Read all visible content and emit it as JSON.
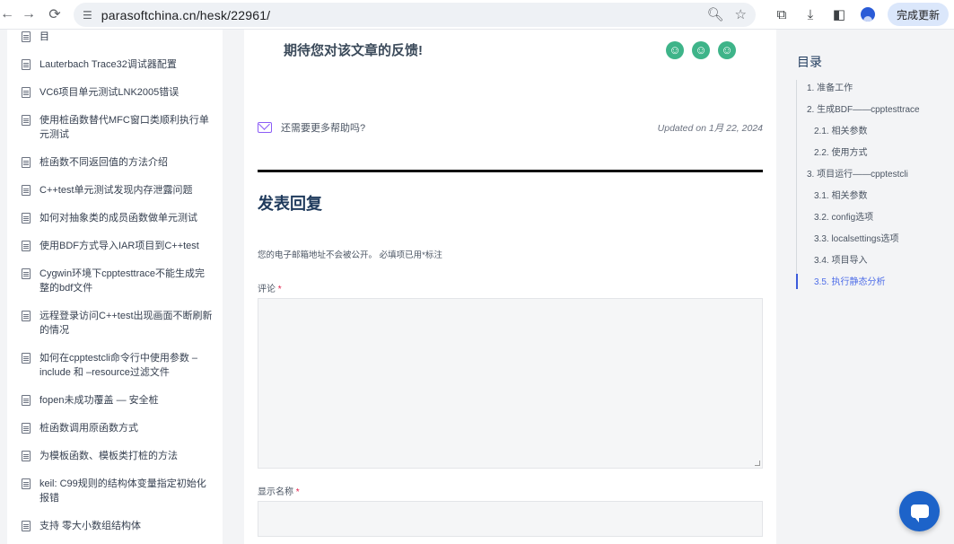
{
  "browser": {
    "url": "parasoftchina.cn/hesk/22961/",
    "update_button": "完成更新"
  },
  "sidebar": {
    "items": [
      {
        "label": "目"
      },
      {
        "label": "Lauterbach Trace32调试器配置"
      },
      {
        "label": "VC6项目单元测试LNK2005错误"
      },
      {
        "label": "使用桩函数替代MFC窗口类顺利执行单元测试"
      },
      {
        "label": "桩函数不同返回值的方法介绍"
      },
      {
        "label": "C++test单元测试发现内存泄露问题"
      },
      {
        "label": "如何对抽象类的成员函数做单元测试"
      },
      {
        "label": "使用BDF方式导入IAR项目到C++test"
      },
      {
        "label": "Cygwin环境下cpptesttrace不能生成完整的bdf文件"
      },
      {
        "label": "远程登录访问C++test出现画面不断刷新的情况"
      },
      {
        "label": "如何在cpptestcli命令行中使用参数 –include 和 –resource过滤文件"
      },
      {
        "label": "fopen未成功覆盖 — 安全桩"
      },
      {
        "label": "桩函数调用原函数方式"
      },
      {
        "label": "为模板函数、模板类打桩的方法"
      },
      {
        "label": "keil: C99规则的结构体变量指定初始化报错"
      },
      {
        "label": "支持 零大小数组结构体"
      }
    ]
  },
  "main": {
    "feedback_title": "期待您对该文章的反馈!",
    "smileys": [
      "☺",
      "☺",
      "☺"
    ],
    "help_text": "还需要更多帮助吗?",
    "updated": "Updated on 1月 22, 2024",
    "reply_title": "发表回复",
    "notes": "您的电子邮箱地址不会被公开。 必填项已用*标注",
    "comment_label": "评论",
    "name_label": "显示名称",
    "required_mark": "*"
  },
  "toc": {
    "title": "目录",
    "items": [
      {
        "label": "1. 准备工作"
      },
      {
        "label": "2. 生成BDF——cpptesttrace"
      },
      {
        "label": "2.1. 相关参数"
      },
      {
        "label": "2.2. 使用方式"
      },
      {
        "label": "3. 项目运行——cpptestcli"
      },
      {
        "label": "3.1. 相关参数"
      },
      {
        "label": "3.2. config选项"
      },
      {
        "label": "3.3. localsettings选项"
      },
      {
        "label": "3.4. 项目导入"
      },
      {
        "label": "3.5. 执行静态分析"
      }
    ]
  },
  "colors": {
    "accent": "#4f6ee8",
    "smiley": "#3eb489",
    "chat": "#1d63c9"
  }
}
